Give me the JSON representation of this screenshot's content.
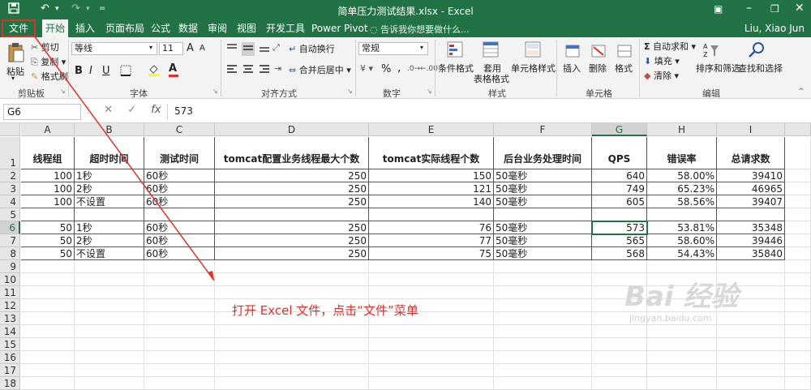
{
  "window": {
    "title": "简单压力测试结果.xlsx - Excel",
    "user": "Liu, Xiao Jun",
    "tell_me_placeholder": "告诉我你想要做什么..."
  },
  "tabs": {
    "file": "文件",
    "items": [
      "开始",
      "插入",
      "页面布局",
      "公式",
      "数据",
      "审阅",
      "视图",
      "开发工具",
      "Power Pivot"
    ]
  },
  "ribbon": {
    "clipboard": {
      "paste": "粘贴",
      "cut": "剪切",
      "copy": "复制",
      "format_painter": "格式刷",
      "label": "剪贴板"
    },
    "font": {
      "name": "等线",
      "size": "11",
      "label": "字体",
      "grow": "A",
      "shrink": "A",
      "bold": "B",
      "italic": "I",
      "underline": "U",
      "color_letter": "A"
    },
    "alignment": {
      "wrap": "自动换行",
      "merge": "合并后居中",
      "label": "对齐方式"
    },
    "number": {
      "format": "常规",
      "percent": "%",
      "comma": ",",
      "label": "数字"
    },
    "styles": {
      "conditional": "条件格式",
      "table_l1": "套用",
      "table_l2": "表格格式",
      "cell_styles": "单元格样式",
      "label": "样式"
    },
    "cells": {
      "insert": "插入",
      "delete": "删除",
      "format": "格式",
      "label": "单元格"
    },
    "editing": {
      "autosum": "自动求和",
      "fill": "填充",
      "clear": "清除",
      "sort": "排序和筛选",
      "find": "查找和选择",
      "label": "编辑"
    }
  },
  "formula_bar": {
    "name_box": "G6",
    "fx": "fx",
    "value": "573"
  },
  "sheet": {
    "columns": [
      "A",
      "B",
      "C",
      "D",
      "E",
      "F",
      "G",
      "H",
      "I"
    ],
    "rows": [
      "1",
      "2",
      "3",
      "4",
      "5",
      "6",
      "7",
      "8",
      "9",
      "10",
      "11",
      "12",
      "13",
      "14",
      "15",
      "16",
      "17",
      "18"
    ],
    "header": [
      "线程组",
      "超时时间",
      "测试时间",
      "tomcat配置业务线程最大个数",
      "tomcat实际线程个数",
      "后台业务处理时间",
      "QPS",
      "错误率",
      "总请求数"
    ],
    "data": [
      [
        "100",
        "1秒",
        "60秒",
        "250",
        "150",
        "50毫秒",
        "640",
        "58.00%",
        "39410"
      ],
      [
        "100",
        "2秒",
        "60秒",
        "250",
        "121",
        "50毫秒",
        "749",
        "65.23%",
        "46965"
      ],
      [
        "100",
        "不设置",
        "60秒",
        "250",
        "140",
        "50毫秒",
        "605",
        "58.56%",
        "39407"
      ],
      [
        "",
        "",
        "",
        "",
        "",
        "",
        "",
        "",
        ""
      ],
      [
        "50",
        "1秒",
        "60秒",
        "250",
        "76",
        "50毫秒",
        "573",
        "53.81%",
        "35348"
      ],
      [
        "50",
        "2秒",
        "60秒",
        "250",
        "77",
        "50毫秒",
        "565",
        "58.60%",
        "39446"
      ],
      [
        "50",
        "不设置",
        "60秒",
        "250",
        "75",
        "50毫秒",
        "568",
        "54.43%",
        "35840"
      ]
    ],
    "selected_cell": "G6"
  },
  "annotation": "打开 Excel 文件，点击“文件”菜单",
  "watermark": {
    "main": "Bai 经验",
    "sub": "jingyan.baidu.com"
  },
  "colors": {
    "excel_green": "#217346",
    "annotation_red": "#e0302b"
  }
}
